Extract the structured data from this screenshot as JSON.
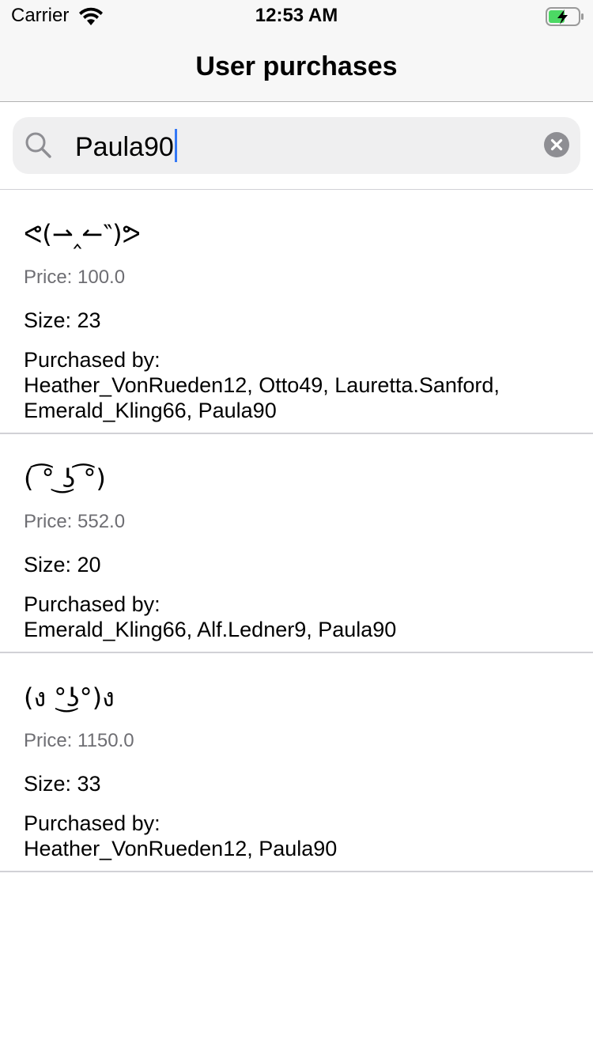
{
  "status_bar": {
    "carrier": "Carrier",
    "time": "12:53 AM",
    "battery_color": "#4cd964"
  },
  "nav": {
    "title": "User purchases"
  },
  "search": {
    "value": "Paula90",
    "caret_color": "#3478f6"
  },
  "items": [
    {
      "emoticon": "ᕙ(⇀‸↼‶)ᕗ",
      "price": "Price: 100.0",
      "size": "Size: 23",
      "purchased_label": "Purchased by:",
      "buyers": "Heather_VonRueden12, Otto49, Lauretta.Sanford, Emerald_Kling66, Paula90"
    },
    {
      "emoticon": "( ͡° ͜ʖ ͡°)",
      "price": "Price: 552.0",
      "size": "Size: 20",
      "purchased_label": "Purchased by:",
      "buyers": "Emerald_Kling66, Alf.Ledner9, Paula90"
    },
    {
      "emoticon": "(ง °͜ʖ°)ง",
      "price": "Price: 1150.0",
      "size": "Size: 33",
      "purchased_label": "Purchased by:",
      "buyers": "Heather_VonRueden12, Paula90"
    }
  ]
}
